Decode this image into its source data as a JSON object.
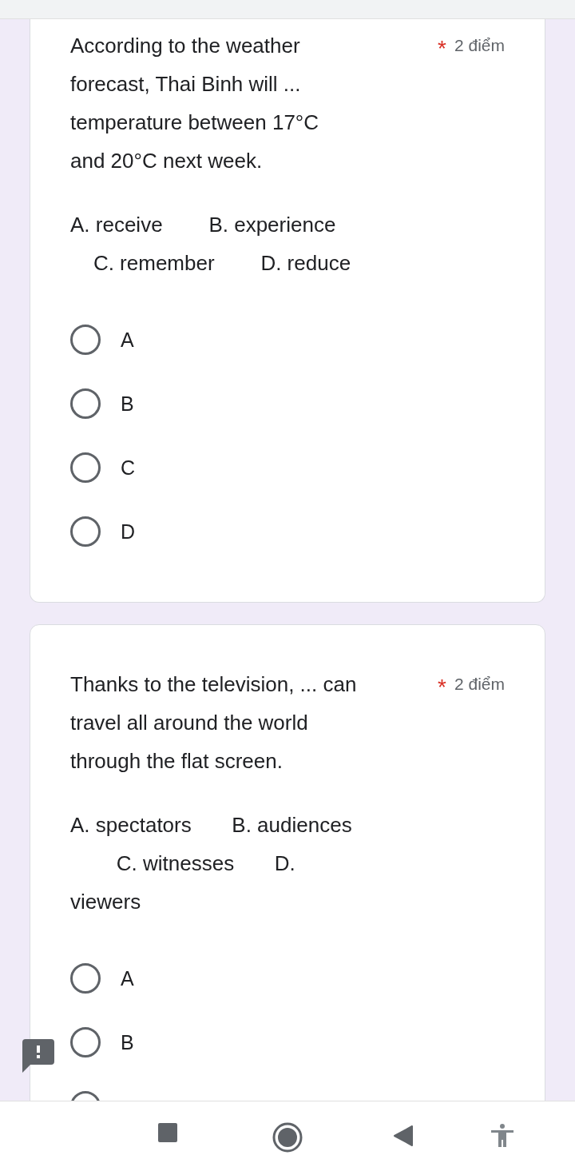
{
  "questions": [
    {
      "title_lines": [
        "According to the weather",
        "forecast, Thai Binh will ...",
        "temperature between 17°C",
        "and 20°C next week."
      ],
      "required_mark": "*",
      "points": "2 điểm",
      "option_lines": [
        "A. receive        B. experience",
        "    C. remember        D. reduce"
      ],
      "choices": [
        {
          "label": "A",
          "selected": false
        },
        {
          "label": "B",
          "selected": false
        },
        {
          "label": "C",
          "selected": false
        },
        {
          "label": "D",
          "selected": false
        }
      ]
    },
    {
      "title_lines": [
        "Thanks to the television, ... can",
        "travel all around the world",
        "through the flat screen."
      ],
      "required_mark": "*",
      "points": "2 điểm",
      "option_lines": [
        "A. spectators       B. audiences",
        "        C. witnesses       D.",
        "viewers"
      ],
      "choices": [
        {
          "label": "A",
          "selected": false
        },
        {
          "label": "B",
          "selected": false
        },
        {
          "selected": false
        }
      ]
    }
  ]
}
